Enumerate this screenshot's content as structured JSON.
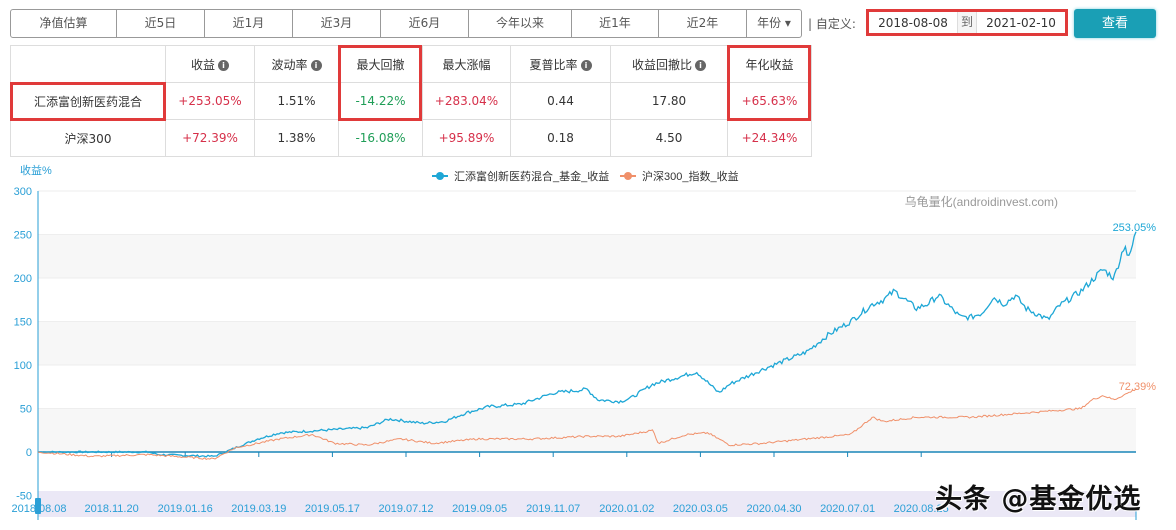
{
  "tabs": [
    "净值估算",
    "近5日",
    "近1月",
    "近3月",
    "近6月",
    "今年以来",
    "近1年",
    "近2年",
    "年份 ▾"
  ],
  "custom_label": "| 自定义:",
  "date_from": "2018-08-08",
  "date_to_label": "到",
  "date_to": "2021-02-10",
  "view_button": "查看",
  "table": {
    "headers": [
      "",
      "收益",
      "波动率",
      "最大回撤",
      "最大涨幅",
      "夏普比率",
      "收益回撤比",
      "年化收益"
    ],
    "info_icon": "i",
    "rows": [
      [
        "汇添富创新医药混合",
        "+253.05%",
        "1.51%",
        "-14.22%",
        "+283.04%",
        "0.44",
        "17.80",
        "+65.63%"
      ],
      [
        "沪深300",
        "+72.39%",
        "1.38%",
        "-16.08%",
        "+95.89%",
        "0.18",
        "4.50",
        "+24.34%"
      ]
    ]
  },
  "chart_data": {
    "type": "line",
    "ylabel": "收益%",
    "ylim": [
      -50,
      300
    ],
    "yticks": [
      "300",
      "250",
      "200",
      "150",
      "100",
      "50",
      "0",
      "-50"
    ],
    "x_unit": "percent of period elapsed",
    "xticks": [
      "2018.08.08",
      "2018.11.20",
      "2019.01.16",
      "2019.03.19",
      "2019.05.17",
      "2019.07.12",
      "2019.09.05",
      "2019.11.07",
      "2020.01.02",
      "2020.03.05",
      "2020.04.30",
      "2020.07.01",
      "2020.08.25"
    ],
    "source_note": "乌龟量化(androidinvest.com)",
    "legend_position": "top-center",
    "series": [
      {
        "name": "汇添富创新医药混合_基金_收益",
        "color": "#1ea7d6",
        "end_label": "253.05%",
        "points": [
          [
            0,
            0
          ],
          [
            10,
            0
          ],
          [
            11,
            -3
          ],
          [
            16,
            -5
          ],
          [
            16.5,
            -3
          ],
          [
            18,
            5
          ],
          [
            20,
            15
          ],
          [
            22,
            22
          ],
          [
            26,
            25
          ],
          [
            30,
            28
          ],
          [
            32,
            38
          ],
          [
            35,
            33
          ],
          [
            37,
            35
          ],
          [
            39,
            45
          ],
          [
            41,
            52
          ],
          [
            44,
            55
          ],
          [
            47,
            68
          ],
          [
            50,
            72
          ],
          [
            51,
            60
          ],
          [
            53,
            58
          ],
          [
            54,
            62
          ],
          [
            56,
            78
          ],
          [
            58,
            85
          ],
          [
            60,
            92
          ],
          [
            61,
            80
          ],
          [
            62,
            68
          ],
          [
            63,
            78
          ],
          [
            66,
            95
          ],
          [
            68,
            105
          ],
          [
            70,
            115
          ],
          [
            72,
            135
          ],
          [
            74,
            150
          ],
          [
            76,
            170
          ],
          [
            77,
            175
          ],
          [
            78,
            185
          ],
          [
            79,
            175
          ],
          [
            80,
            165
          ],
          [
            81,
            170
          ],
          [
            82,
            180
          ],
          [
            84,
            155
          ],
          [
            85,
            155
          ],
          [
            86,
            160
          ],
          [
            87,
            178
          ],
          [
            88,
            170
          ],
          [
            89,
            180
          ],
          [
            90,
            165
          ],
          [
            92,
            152
          ],
          [
            93,
            168
          ],
          [
            95,
            185
          ],
          [
            97,
            210
          ],
          [
            98,
            200
          ],
          [
            99,
            240
          ],
          [
            99.3,
            220
          ],
          [
            100,
            253.05
          ]
        ]
      },
      {
        "name": "沪深300_指数_收益",
        "color": "#f0906a",
        "end_label": "72.39%",
        "points": [
          [
            0,
            0
          ],
          [
            5,
            -5
          ],
          [
            10,
            -3
          ],
          [
            16,
            -8
          ],
          [
            18,
            5
          ],
          [
            22,
            15
          ],
          [
            25,
            20
          ],
          [
            27,
            10
          ],
          [
            30,
            8
          ],
          [
            33,
            15
          ],
          [
            36,
            10
          ],
          [
            40,
            15
          ],
          [
            45,
            15
          ],
          [
            50,
            18
          ],
          [
            53,
            18
          ],
          [
            56,
            25
          ],
          [
            56.5,
            10
          ],
          [
            59,
            20
          ],
          [
            61,
            22
          ],
          [
            63,
            8
          ],
          [
            66,
            10
          ],
          [
            70,
            15
          ],
          [
            74,
            20
          ],
          [
            75,
            30
          ],
          [
            76,
            40
          ],
          [
            77,
            35
          ],
          [
            80,
            40
          ],
          [
            85,
            40
          ],
          [
            90,
            45
          ],
          [
            95,
            50
          ],
          [
            96,
            60
          ],
          [
            97,
            65
          ],
          [
            98,
            60
          ],
          [
            100,
            72.39
          ]
        ]
      }
    ]
  },
  "watermark": "头条 @基金优选"
}
